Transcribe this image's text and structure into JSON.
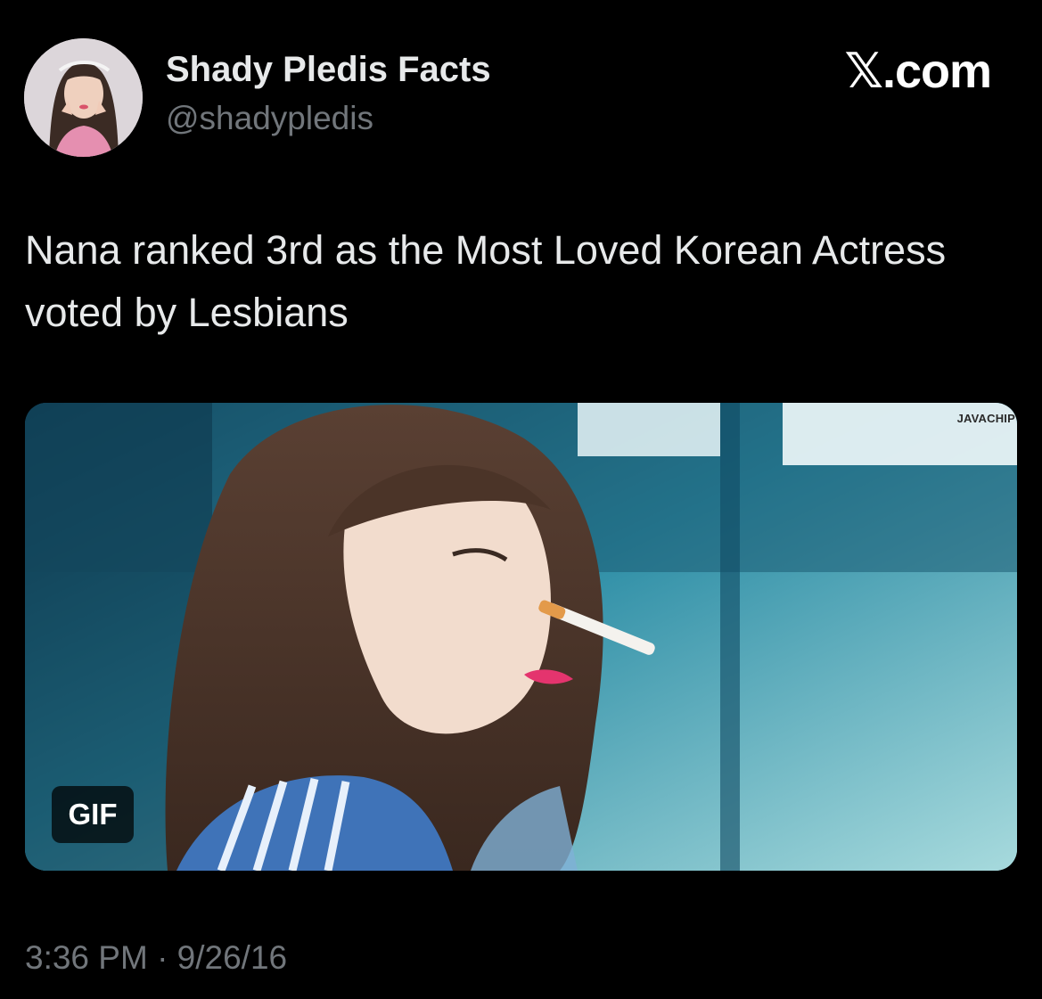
{
  "author": {
    "display_name": "Shady Pledis Facts",
    "handle": "@shadypledis"
  },
  "brand": {
    "text": "𝕏.com",
    "icon": "x-logo-icon"
  },
  "tweet": {
    "text": "Nana ranked 3rd as the Most Loved Korean Actress voted by Lesbians",
    "timestamp": "3:36 PM · 9/26/16"
  },
  "media": {
    "badge": "GIF",
    "watermark": "JAVACHIP"
  },
  "colors": {
    "background": "#000000",
    "primary_text": "#e7e9ea",
    "secondary_text": "#71767b"
  }
}
